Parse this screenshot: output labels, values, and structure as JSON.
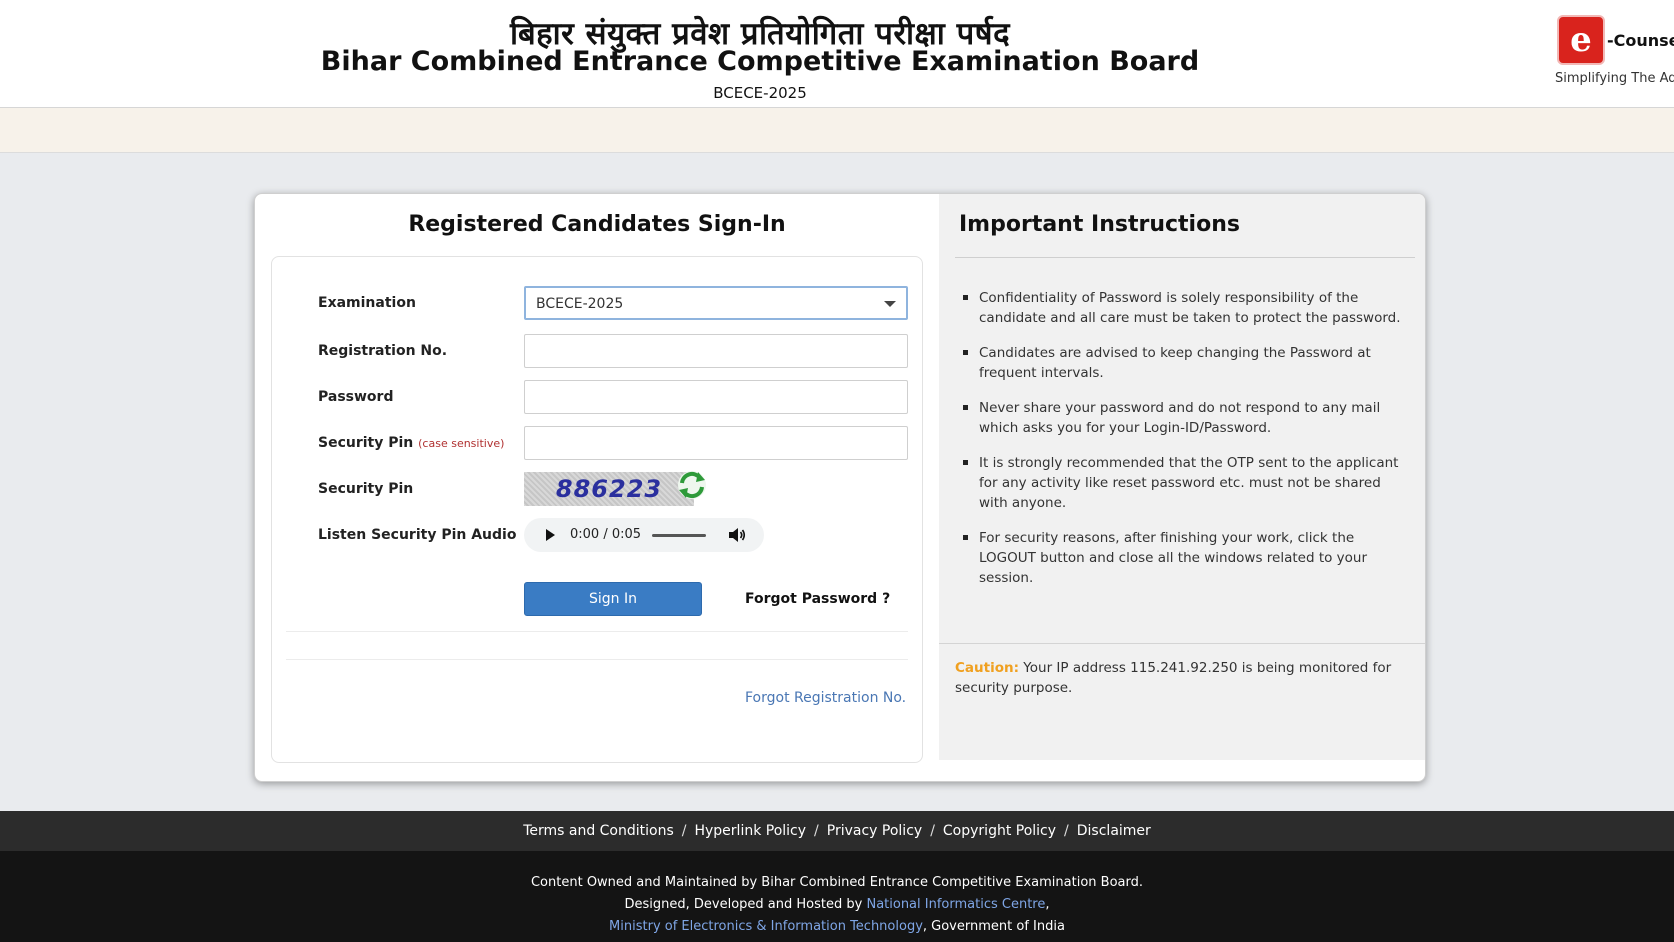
{
  "header": {
    "hindi_title": "बिहार संयुक्त प्रवेश प्रतियोगिता परीक्षा पर्षद",
    "english_title": "Bihar Combined Entrance Competitive Examination Board",
    "subtitle": "BCECE-2025",
    "brand_icon_letter": "e",
    "brand_name": "-Counsell",
    "brand_tagline": "Simplifying The Ad"
  },
  "signin": {
    "title": "Registered Candidates Sign-In",
    "examination_label": "Examination",
    "examination_value": "BCECE-2025",
    "registration_label": "Registration No.",
    "registration_value": "",
    "password_label": "Password",
    "password_value": "",
    "security_pin_label": "Security Pin",
    "security_pin_note": "(case sensitive)",
    "security_pin_value": "",
    "captcha_label": "Security Pin",
    "captcha_value": "886223",
    "audio_label": "Listen Security Pin Audio",
    "audio_time": "0:00 / 0:05",
    "signin_button": "Sign In",
    "forgot_password": "Forgot Password ?",
    "forgot_registration": "Forgot Registration No."
  },
  "instructions": {
    "title": "Important Instructions",
    "items": [
      "Confidentiality of Password is solely responsibility of the candidate and all care must be taken to protect the password.",
      "Candidates are advised to keep changing the Password at frequent intervals.",
      "Never share your password and do not respond to any mail which asks you for your Login-ID/Password.",
      "It is strongly recommended that the OTP sent to the applicant for any activity like reset password etc. must not be shared with anyone.",
      "For security reasons, after finishing your work, click the LOGOUT button and close all the windows related to your session."
    ],
    "caution_label": "Caution:",
    "caution_text": "Your IP address 115.241.92.250 is being monitored for security purpose."
  },
  "footer": {
    "links": [
      "Terms and Conditions",
      "Hyperlink Policy",
      "Privacy Policy",
      "Copyright Policy",
      "Disclaimer"
    ],
    "separator": "/",
    "line1": "Content Owned and Maintained by Bihar Combined Entrance Competitive Examination Board.",
    "line2_prefix": "Designed, Developed and Hosted by",
    "line2_link": "National Informatics Centre",
    "line2_suffix": ",",
    "line3_link": "Ministry of Electronics & Information Technology",
    "line3_suffix": ", Government of India"
  },
  "colors": {
    "button_blue": "#3a7cc4",
    "caution_orange": "#f0a020",
    "link_blue": "#4a77b4",
    "brand_red": "#d9231d"
  }
}
